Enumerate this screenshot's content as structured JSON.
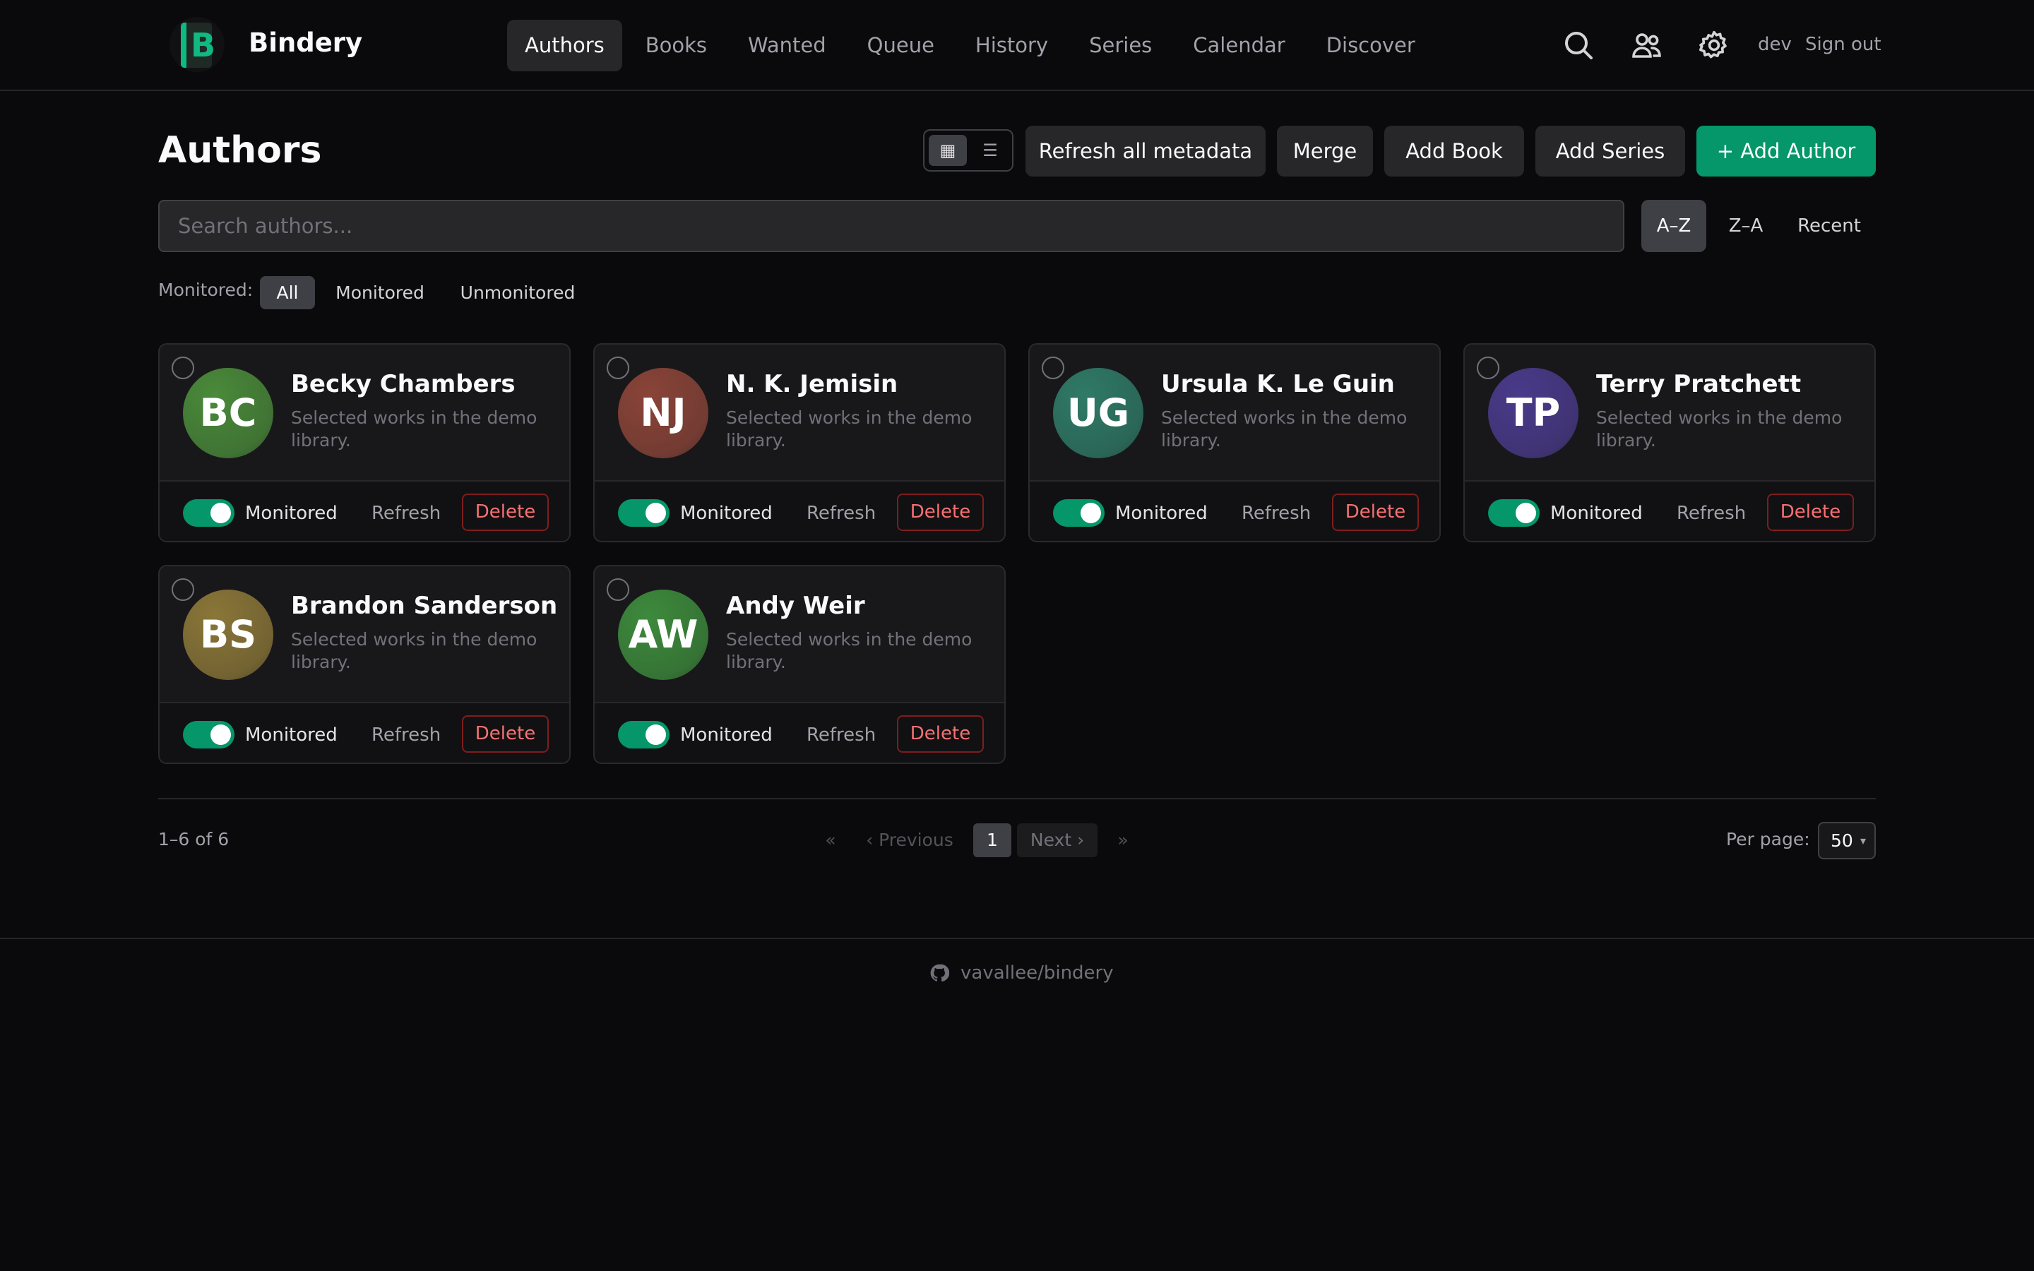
{
  "app": {
    "logo_letter": "B",
    "name": "Bindery",
    "accent": "#059669"
  },
  "nav": {
    "items": [
      {
        "label": "Authors",
        "active": true
      },
      {
        "label": "Books"
      },
      {
        "label": "Wanted"
      },
      {
        "label": "Queue"
      },
      {
        "label": "History"
      },
      {
        "label": "Series"
      },
      {
        "label": "Calendar"
      },
      {
        "label": "Discover"
      }
    ]
  },
  "header": {
    "icons": [
      "search-icon",
      "users-icon",
      "gear-icon"
    ],
    "username": "dev",
    "signout_label": "Sign out"
  },
  "page": {
    "title": "Authors",
    "view_grid_glyph": "▦",
    "view_list_glyph": "☰",
    "buttons": {
      "refresh_all": "Refresh all metadata",
      "merge": "Merge",
      "add_book": "Add Book",
      "add_series": "Add Series",
      "add_author": "+ Add Author"
    }
  },
  "search": {
    "placeholder": "Search authors...",
    "value": ""
  },
  "sort": {
    "options": [
      "A–Z",
      "Z–A",
      "Recent"
    ],
    "selected": "A–Z"
  },
  "filter": {
    "label": "Monitored:",
    "options": [
      "All",
      "Monitored",
      "Unmonitored"
    ],
    "selected": "All"
  },
  "authors": [
    {
      "initials": "BC",
      "name": "Becky Chambers",
      "description": "Selected works in the demo library.",
      "color": "#4a8a3a",
      "monitored": true
    },
    {
      "initials": "NJ",
      "name": "N. K. Jemisin",
      "description": "Selected works in the demo library.",
      "color": "#8a4438",
      "monitored": true
    },
    {
      "initials": "UG",
      "name": "Ursula K. Le Guin",
      "description": "Selected works in the demo library.",
      "color": "#2f7a66",
      "monitored": true
    },
    {
      "initials": "TP",
      "name": "Terry Pratchett",
      "description": "Selected works in the demo library.",
      "color": "#4a3a8a",
      "monitored": true
    },
    {
      "initials": "BS",
      "name": "Brandon Sanderson",
      "description": "Selected works in the demo library.",
      "color": "#8a7638",
      "monitored": true
    },
    {
      "initials": "AW",
      "name": "Andy Weir",
      "description": "Selected works in the demo library.",
      "color": "#3d8a3c",
      "monitored": true
    }
  ],
  "card_labels": {
    "monitored": "Monitored",
    "refresh": "Refresh",
    "delete": "Delete"
  },
  "pagination": {
    "range": "1–6 of 6",
    "first": "«",
    "previous": "‹ Previous",
    "current": "1",
    "next": "Next ›",
    "last": "»",
    "per_page_label": "Per page:",
    "per_page_value": "50"
  },
  "footer": {
    "repo": "vavallee/bindery"
  }
}
